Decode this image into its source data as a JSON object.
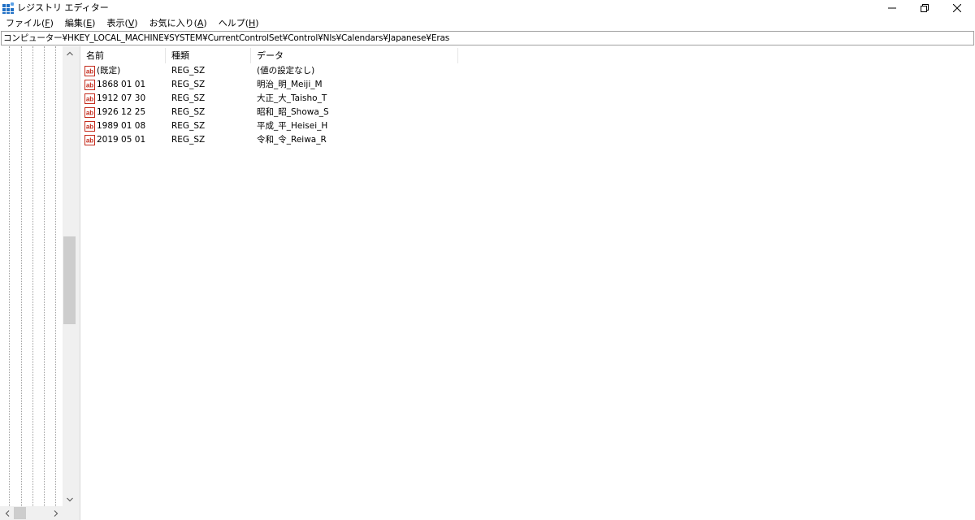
{
  "window": {
    "title": "レジストリ エディター"
  },
  "menu": [
    {
      "label": "ファイル(",
      "key": "F",
      "suffix": ")"
    },
    {
      "label": "編集(",
      "key": "E",
      "suffix": ")"
    },
    {
      "label": "表示(",
      "key": "V",
      "suffix": ")"
    },
    {
      "label": "お気に入り(",
      "key": "A",
      "suffix": ")"
    },
    {
      "label": "ヘルプ(",
      "key": "H",
      "suffix": ")"
    }
  ],
  "address": {
    "path": "コンピューター¥HKEY_LOCAL_MACHINE¥SYSTEM¥CurrentControlSet¥Control¥Nls¥Calendars¥Japanese¥Eras"
  },
  "list": {
    "columns": {
      "name": "名前",
      "type": "種類",
      "data": "データ"
    },
    "rows": [
      {
        "name": "(既定)",
        "type": "REG_SZ",
        "data": "(値の設定なし)"
      },
      {
        "name": "1868 01 01",
        "type": "REG_SZ",
        "data": "明治_明_Meiji_M"
      },
      {
        "name": "1912 07 30",
        "type": "REG_SZ",
        "data": "大正_大_Taisho_T"
      },
      {
        "name": "1926 12 25",
        "type": "REG_SZ",
        "data": "昭和_昭_Showa_S"
      },
      {
        "name": "1989 01 08",
        "type": "REG_SZ",
        "data": "平成_平_Heisei_H"
      },
      {
        "name": "2019 05 01",
        "type": "REG_SZ",
        "data": "令和_令_Reiwa_R"
      }
    ]
  },
  "icons": {
    "app": "registry-editor-icon",
    "value": "reg-sz-string-icon"
  },
  "colors": {
    "reg_icon_red": "#c42b1c",
    "app_icon_blue": "#1f6fc5"
  }
}
